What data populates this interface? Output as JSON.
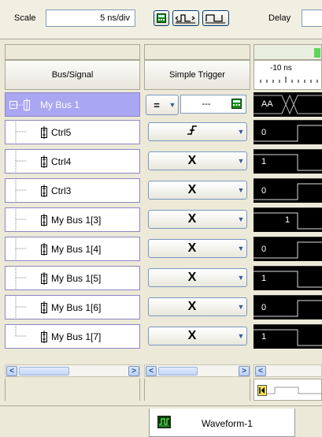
{
  "toolbar": {
    "scale_label": "Scale",
    "scale_value": "5 ns/div",
    "delay_label": "Delay"
  },
  "columns": {
    "signal_header": "Bus/Signal",
    "trigger_header": "Simple Trigger",
    "time_tick": "-10 ns"
  },
  "rows": [
    {
      "name": "My Bus 1",
      "trigger": "=",
      "value": "AA"
    },
    {
      "name": "Ctrl5",
      "trigger": "rising-edge",
      "value": "0"
    },
    {
      "name": "Ctrl4",
      "trigger": "X",
      "value": "1"
    },
    {
      "name": "Ctrl3",
      "trigger": "X",
      "value": "0"
    },
    {
      "name": "My Bus 1[3]",
      "trigger": "X",
      "value": "1"
    },
    {
      "name": "My Bus 1[4]",
      "trigger": "X",
      "value": "0"
    },
    {
      "name": "My Bus 1[5]",
      "trigger": "X",
      "value": "1"
    },
    {
      "name": "My Bus 1[6]",
      "trigger": "X",
      "value": "0"
    },
    {
      "name": "My Bus 1[7]",
      "trigger": "X",
      "value": "1"
    }
  ],
  "bus_trigger_value": "---",
  "tabs": [
    {
      "label": "Waveform-1",
      "active": true
    }
  ],
  "colors": {
    "background": "#ece9d8",
    "selected_row": "#a9a6f2",
    "row_border": "#8f86c4",
    "waveform_bg": "#000000",
    "waveform_fg": "#ffffff"
  }
}
